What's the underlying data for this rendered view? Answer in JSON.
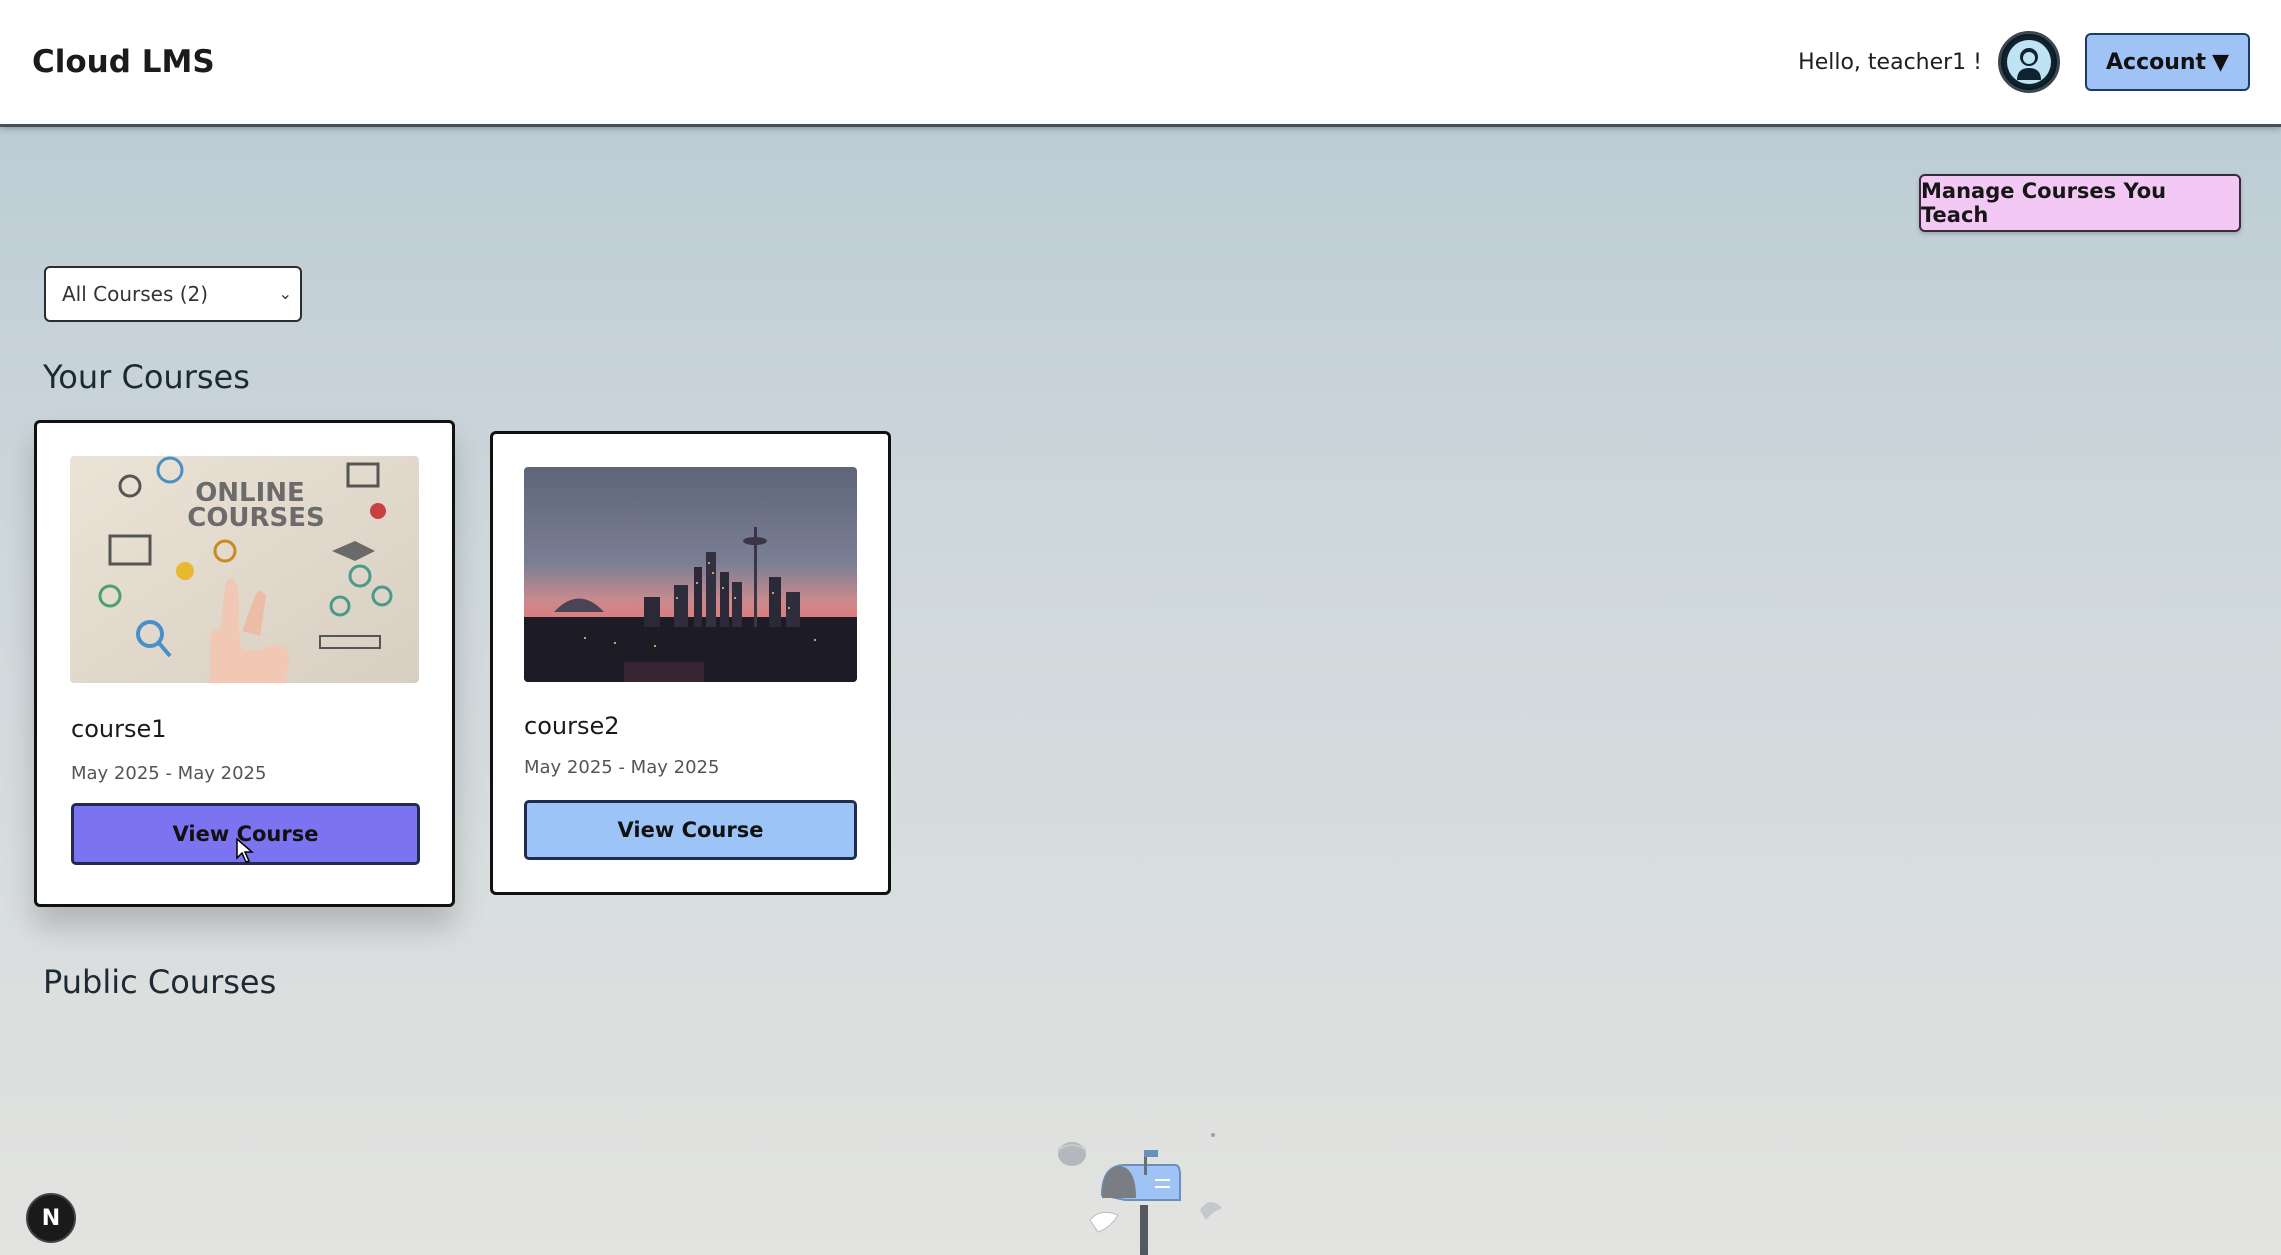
{
  "app": {
    "title": "Cloud LMS"
  },
  "header": {
    "greeting": "Hello, teacher1 !",
    "account_label": "Account",
    "account_caret": "▼",
    "avatar_icon": "user-avatar-icon"
  },
  "toolbar": {
    "manage_label": "Manage Courses You Teach",
    "filter_selected": "All Courses (2)"
  },
  "sections": {
    "your_courses": "Your Courses",
    "public_courses": "Public Courses"
  },
  "courses": [
    {
      "name": "course1",
      "dates": "May 2025 - May 2025",
      "button": "View Course",
      "image": "online-courses-illustration",
      "image_text_line1": "ONLINE",
      "image_text_line2": "COURSES"
    },
    {
      "name": "course2",
      "dates": "May 2025 - May 2025",
      "button": "View Course",
      "image": "city-skyline-photo"
    }
  ],
  "footer": {
    "dev_badge": "N"
  },
  "colors": {
    "view_button_hover": "#7c73f0",
    "view_button": "#9cc4f7",
    "account_button": "#9fc3f4",
    "manage_button": "#f4c8f4"
  }
}
